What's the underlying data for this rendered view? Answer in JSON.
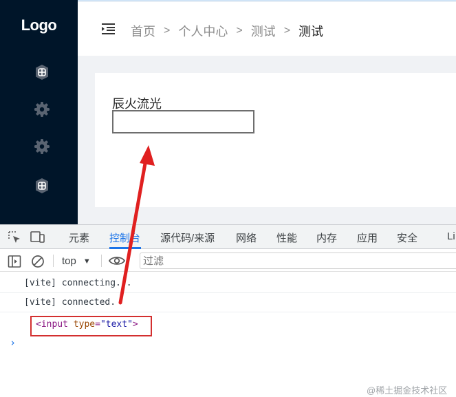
{
  "app": {
    "logo": "Logo",
    "sidebar_icons": [
      "grid-icon",
      "gear-icon",
      "gear-icon",
      "grid-icon"
    ],
    "breadcrumb": {
      "items": [
        "首页",
        "个人中心",
        "测试"
      ],
      "current": "测试",
      "separator": ">"
    },
    "form": {
      "label": "辰火流光",
      "input_value": ""
    }
  },
  "devtools": {
    "tabs": [
      "元素",
      "控制台",
      "源代码/来源",
      "网络",
      "性能",
      "内存",
      "应用",
      "安全",
      "Li"
    ],
    "active_tab": "控制台",
    "toolbar": {
      "context": "top",
      "filter_placeholder": "过滤"
    },
    "logs": [
      "[vite] connecting...",
      "[vite] connected."
    ],
    "logged_node": {
      "tag_open": "<input",
      "attr_name": "type",
      "attr_eq": "=",
      "attr_value": "\"text\"",
      "tag_close": ">"
    },
    "prompt": "›"
  },
  "watermark": "@稀土掘金技术社区",
  "colors": {
    "sidebar_bg": "#001529",
    "active_tab": "#1a73e8",
    "annotation_red": "#d32f2f"
  }
}
